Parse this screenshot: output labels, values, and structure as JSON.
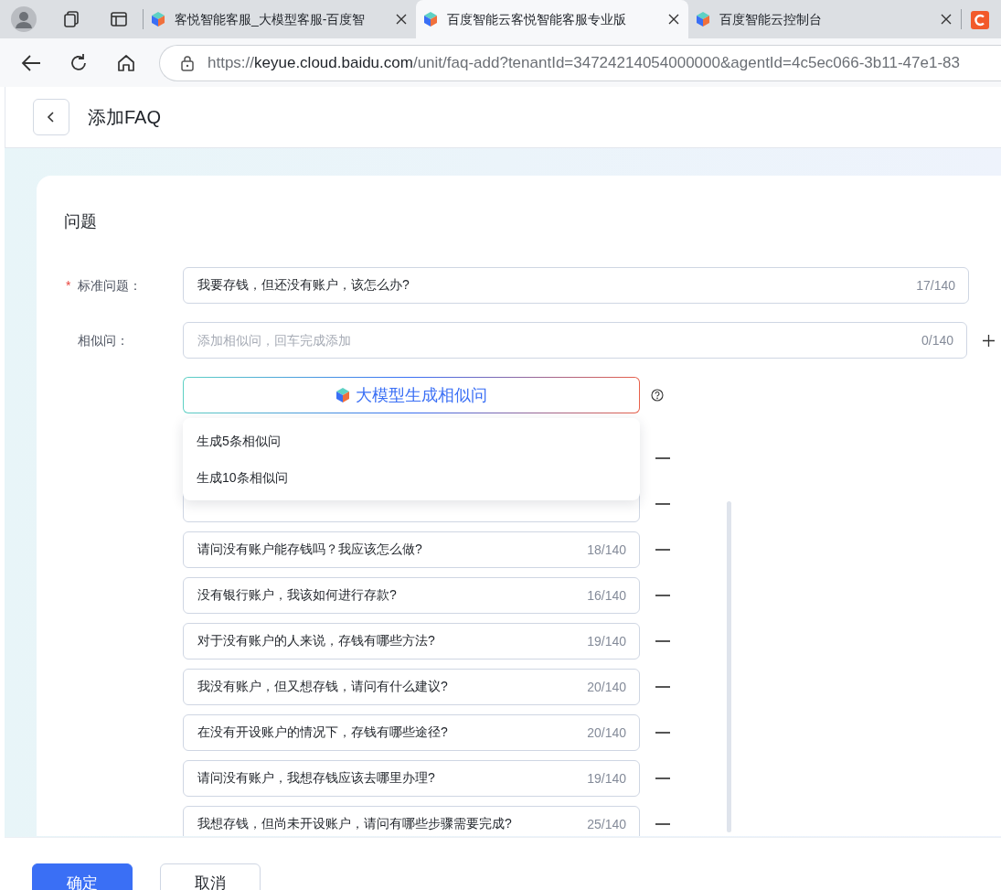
{
  "browser": {
    "tabs": [
      {
        "title": "客悦智能客服_大模型客服-百度智",
        "selected": false
      },
      {
        "title": "百度智能云客悦智能客服专业版",
        "selected": true
      },
      {
        "title": "百度智能云控制台",
        "selected": false
      }
    ],
    "url": {
      "scheme": "https://",
      "host": "keyue.cloud.baidu.com",
      "path": "/unit/faq-add?tenantId=34724214054000000&agentId=4c5ec066-3b11-47e1-83"
    }
  },
  "page": {
    "title": "添加FAQ"
  },
  "section": {
    "title": "问题"
  },
  "standard_question": {
    "required_mark": "*",
    "label": "标准问题：",
    "value": "我要存钱，但还没有账户，该怎么办?",
    "count": "17/140"
  },
  "similar_input": {
    "label": "相似问：",
    "placeholder": "添加相似问，回车完成添加",
    "count": "0/140"
  },
  "generate_button": {
    "label": "大模型生成相似问"
  },
  "generate_menu": {
    "items": [
      "生成5条相似问",
      "生成10条相似问"
    ]
  },
  "similar_questions": [
    {
      "kind": "covered"
    },
    {
      "kind": "cut"
    },
    {
      "kind": "field",
      "text": "请问没有账户能存钱吗？我应该怎么做?",
      "count": "18/140"
    },
    {
      "kind": "field",
      "text": "没有银行账户，我该如何进行存款?",
      "count": "16/140"
    },
    {
      "kind": "field",
      "text": "对于没有账户的人来说，存钱有哪些方法?",
      "count": "19/140"
    },
    {
      "kind": "field",
      "text": "我没有账户，但又想存钱，请问有什么建议?",
      "count": "20/140"
    },
    {
      "kind": "field",
      "text": "在没有开设账户的情况下，存钱有哪些途径?",
      "count": "20/140"
    },
    {
      "kind": "field",
      "text": "请问没有账户，我想存钱应该去哪里办理?",
      "count": "19/140"
    },
    {
      "kind": "field",
      "text": "我想存钱，但尚未开设账户，请问有哪些步骤需要完成?",
      "count": "25/140"
    }
  ],
  "footer": {
    "buttons": [
      {
        "label": "确定",
        "kind": "primary"
      },
      {
        "label": "取消",
        "kind": "secondary"
      }
    ]
  }
}
